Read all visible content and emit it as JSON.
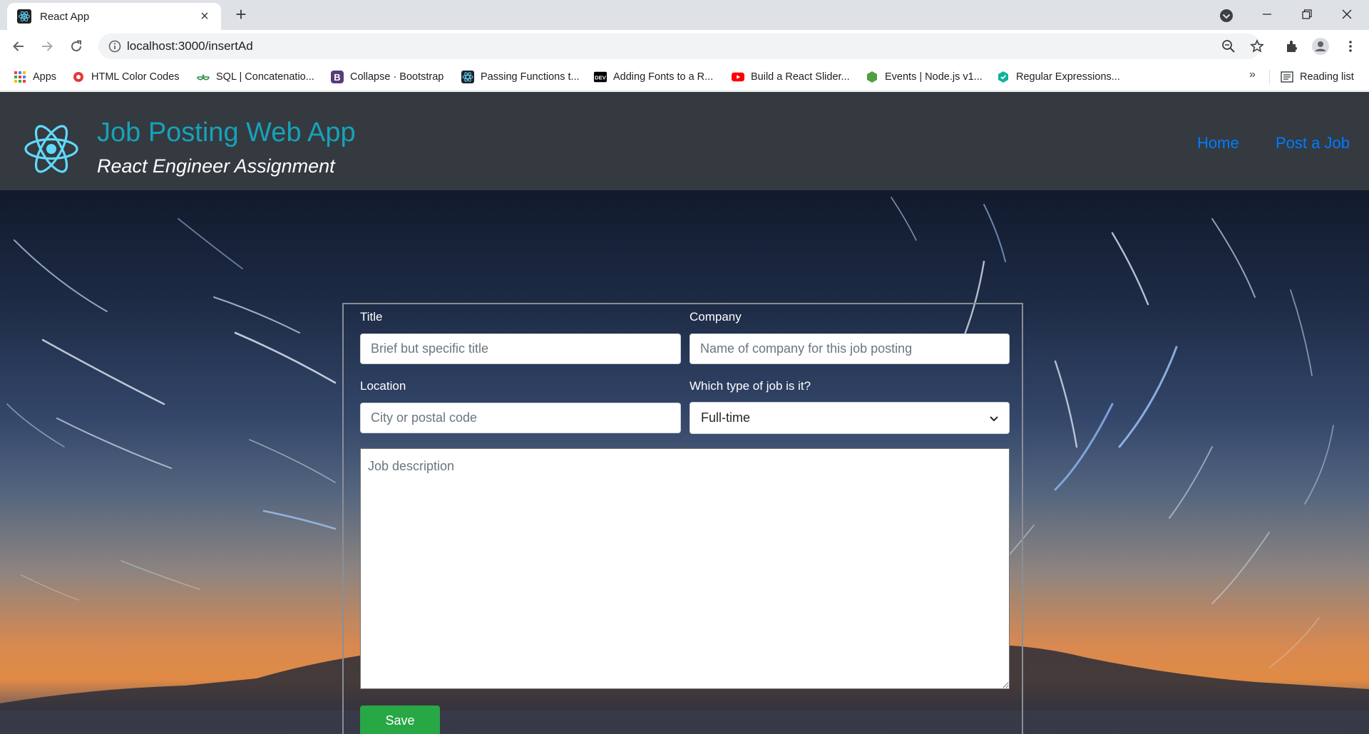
{
  "browser": {
    "tab_title": "React App",
    "url": "localhost:3000/insertAd",
    "bookmarks": [
      {
        "label": "Apps",
        "icon": "apps-grid-icon"
      },
      {
        "label": "HTML Color Codes",
        "icon": "html-color-codes-icon"
      },
      {
        "label": "SQL | Concatenatio...",
        "icon": "geeksforgeeks-icon"
      },
      {
        "label": "Collapse · Bootstrap",
        "icon": "bootstrap-icon"
      },
      {
        "label": "Passing Functions t...",
        "icon": "react-icon"
      },
      {
        "label": "Adding Fonts to a R...",
        "icon": "dev-icon"
      },
      {
        "label": "Build a React Slider...",
        "icon": "youtube-icon"
      },
      {
        "label": "Events | Node.js v1...",
        "icon": "nodejs-icon"
      },
      {
        "label": "Regular Expressions...",
        "icon": "regex-icon"
      }
    ],
    "reading_list": "Reading list",
    "chevron": "»"
  },
  "app": {
    "brand_title": "Job Posting Web App",
    "brand_subtitle": "React Engineer Assignment",
    "nav": {
      "home": "Home",
      "post_job": "Post a Job"
    }
  },
  "form": {
    "title_label": "Title",
    "title_placeholder": "Brief but specific title",
    "company_label": "Company",
    "company_placeholder": "Name of company for this job posting",
    "location_label": "Location",
    "location_placeholder": "City or postal code",
    "type_label": "Which type of job is it?",
    "type_value": "Full-time",
    "description_placeholder": "Job description",
    "save_label": "Save"
  },
  "colors": {
    "navbar_bg": "#343a40",
    "brand": "#17a2b8",
    "nav_link": "#007bff",
    "save": "#28a745"
  }
}
